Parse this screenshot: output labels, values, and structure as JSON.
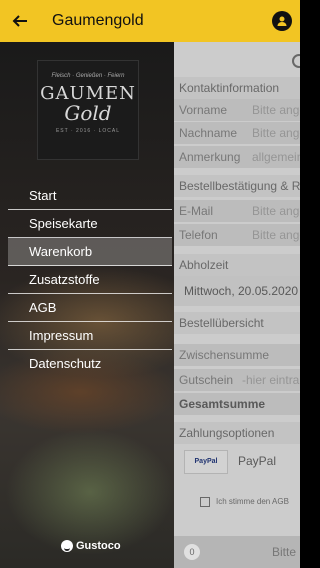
{
  "appbar": {
    "title": "Gaumengold",
    "back_icon": "arrow-left-icon",
    "account_icon": "account-circle-icon",
    "color": "#f2c523"
  },
  "drawer": {
    "logo": {
      "top": "Fleisch · Genießen · Feiern",
      "main": "GAUMEN",
      "script": "Gold",
      "bottom": "EST · 2016 · LOCAL"
    },
    "menu": [
      "Start",
      "Speisekarte",
      "Warenkorb",
      "Zusatzstoffe",
      "AGB",
      "Impressum",
      "Datenschutz"
    ],
    "active_index": 2,
    "powered_by": "Gustoco"
  },
  "page": {
    "sections": {
      "contact": "Kontaktinformation",
      "confirmation": "Bestellbestätigung & Rü",
      "pickup": "Abholzeit",
      "overview": "Bestellübersicht",
      "payment": "Zahlungsoptionen"
    },
    "fields": {
      "first_name": {
        "label": "Vorname",
        "placeholder": "Bitte ange"
      },
      "last_name": {
        "label": "Nachname",
        "placeholder": "Bitte ange"
      },
      "note": {
        "label": "Anmerkung",
        "placeholder": "allgemeine"
      },
      "email": {
        "label": "E-Mail",
        "placeholder": "Bitte ange"
      },
      "phone": {
        "label": "Telefon",
        "placeholder": "Bitte ange"
      }
    },
    "pickup_value": "Mittwoch, 20.05.2020",
    "subtotal_label": "Zwischensumme",
    "voucher_label": "Gutschein",
    "voucher_placeholder": "-hier eintra",
    "total_label": "Gesamtsumme",
    "paypal": {
      "logo": "PayPal",
      "label": "PayPal"
    },
    "terms_text": "Ich stimme den AGB",
    "footer": {
      "count": "0",
      "text": "Bitte"
    }
  }
}
